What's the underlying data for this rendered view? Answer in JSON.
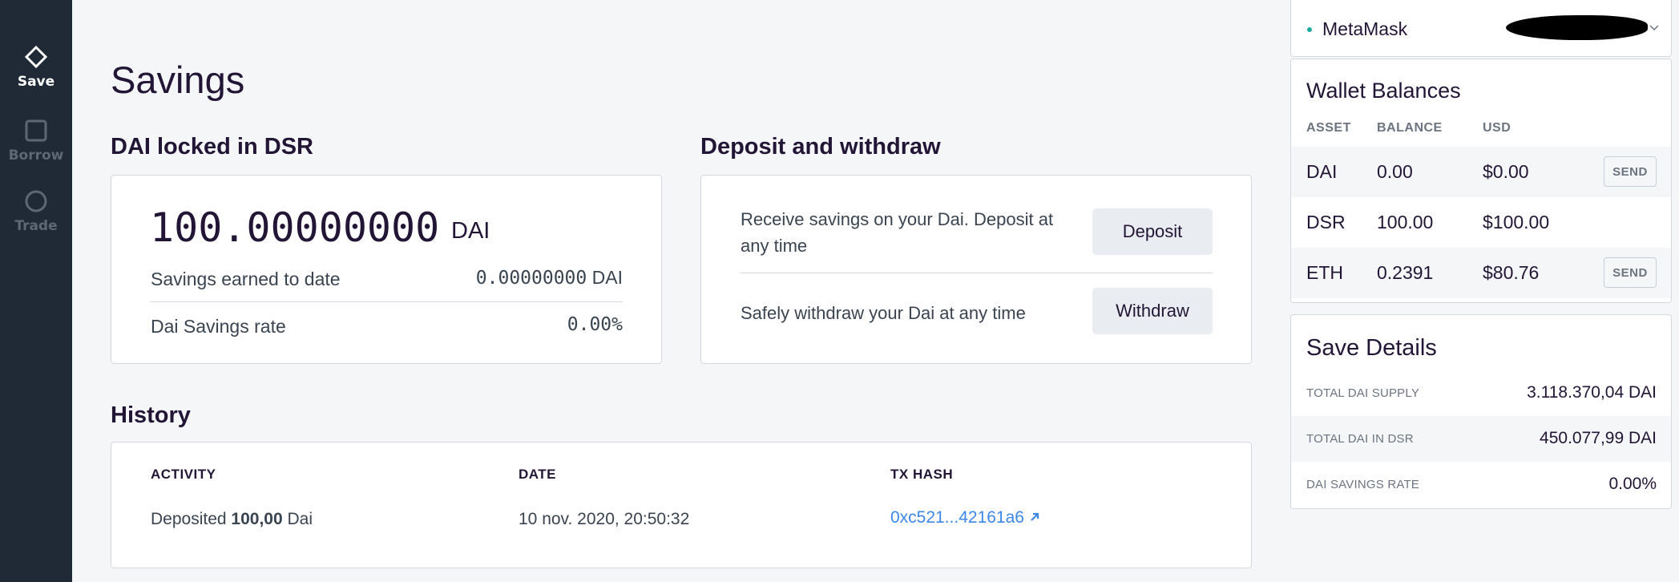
{
  "sidebar": {
    "items": [
      {
        "label": "Save",
        "icon": "diamond-icon",
        "active": true
      },
      {
        "label": "Borrow",
        "icon": "square-icon",
        "active": false
      },
      {
        "label": "Trade",
        "icon": "circle-icon",
        "active": false
      }
    ]
  },
  "page": {
    "title": "Savings"
  },
  "dsr": {
    "section_title": "DAI locked in DSR",
    "amount": "100.00000000",
    "amount_unit": "DAI",
    "earned_label": "Savings earned to date",
    "earned_value": "0.00000000",
    "earned_unit": "DAI",
    "rate_label": "Dai Savings rate",
    "rate_value": "0.00%"
  },
  "deposit_withdraw": {
    "section_title": "Deposit and withdraw",
    "deposit_text": "Receive savings on your Dai. Deposit at any time",
    "deposit_button": "Deposit",
    "withdraw_text": "Safely withdraw your Dai at any time",
    "withdraw_button": "Withdraw"
  },
  "history": {
    "section_title": "History",
    "columns": [
      "ACTIVITY",
      "DATE",
      "TX HASH"
    ],
    "rows": [
      {
        "activity_prefix": "Deposited ",
        "activity_amount": "100,00",
        "activity_suffix": " Dai",
        "date": "10 nov. 2020, 20:50:32",
        "tx_hash": "0xc521...42161a6"
      }
    ]
  },
  "wallet": {
    "name": "MetaMask",
    "status_color": "#1aab9b"
  },
  "balances": {
    "title": "Wallet Balances",
    "columns": [
      "ASSET",
      "BALANCE",
      "USD"
    ],
    "rows": [
      {
        "asset": "DAI",
        "balance": "0.00",
        "usd": "$0.00",
        "action": "SEND"
      },
      {
        "asset": "DSR",
        "balance": "100.00",
        "usd": "$100.00",
        "action": ""
      },
      {
        "asset": "ETH",
        "balance": "0.2391",
        "usd": "$80.76",
        "action": "SEND"
      }
    ]
  },
  "save_details": {
    "title": "Save Details",
    "rows": [
      {
        "label": "TOTAL DAI SUPPLY",
        "value": "3.118.370,04 DAI"
      },
      {
        "label": "TOTAL DAI IN DSR",
        "value": "450.077,99 DAI"
      },
      {
        "label": "DAI SAVINGS RATE",
        "value": "0.00%"
      }
    ]
  },
  "colors": {
    "sidebar_bg": "#1f2a36",
    "page_bg": "#f5f6f8",
    "text_primary": "#231536",
    "link": "#3c87e8"
  }
}
